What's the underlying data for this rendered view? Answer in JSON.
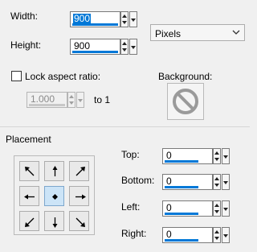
{
  "size": {
    "width_label": "Width:",
    "width_value": "900",
    "height_label": "Height:",
    "height_value": "900",
    "units": "Pixels"
  },
  "aspect": {
    "lock_label": "Lock aspect ratio:",
    "ratio_value": "1.000",
    "to_label": "to 1"
  },
  "background": {
    "label": "Background:",
    "swatch_icon": "no-color-icon"
  },
  "placement": {
    "heading": "Placement",
    "buttons": [
      {
        "icon": "arrow-up-left-icon"
      },
      {
        "icon": "arrow-up-icon"
      },
      {
        "icon": "arrow-up-right-icon"
      },
      {
        "icon": "arrow-left-icon"
      },
      {
        "icon": "center-dot-icon",
        "active": true
      },
      {
        "icon": "arrow-right-icon"
      },
      {
        "icon": "arrow-down-left-icon"
      },
      {
        "icon": "arrow-down-icon"
      },
      {
        "icon": "arrow-down-right-icon"
      }
    ],
    "top_label": "Top:",
    "top_value": "0",
    "bottom_label": "Bottom:",
    "bottom_value": "0",
    "left_label": "Left:",
    "left_value": "0",
    "right_label": "Right:",
    "right_value": "0"
  },
  "colors": {
    "accent": "#0078d7",
    "active_button": "#cce4f7",
    "background": "#f0f0f0"
  }
}
